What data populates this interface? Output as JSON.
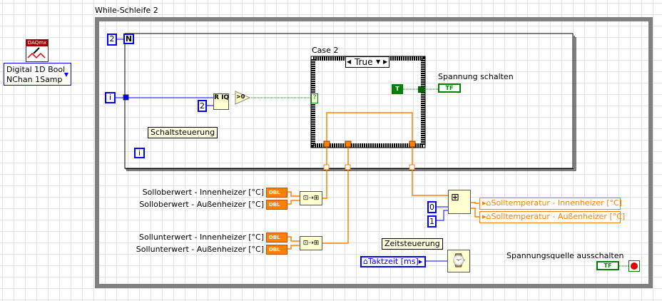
{
  "colors": {
    "numeric_wire": "#0000ff",
    "double_wire": "#ff8000",
    "boolean_wire": "#008000",
    "while_loop": "#808080"
  },
  "daqmx": {
    "icon_text": "DAQmx",
    "ring_line1": "Digital 1D Bool",
    "ring_line2": "NChan 1Samp"
  },
  "while_loop": {
    "label": "While-Schleife 2",
    "iteration": "i"
  },
  "for_loop": {
    "count_const": "2",
    "count_terminal": "N",
    "iteration": "i",
    "comment": "Schaltsteuerung",
    "divisor_const": "2",
    "quotient_icon": "R IQ",
    "compare": ">0"
  },
  "case": {
    "label": "Case 2",
    "selector_value": "True",
    "true_const": "T",
    "selector_terminal": "?"
  },
  "indicator_switch": {
    "label": "Spannung schalten",
    "type": "TF"
  },
  "controls": [
    {
      "label": "Solloberwert - Innenheizer [°C]",
      "type": "DBL"
    },
    {
      "label": "Solloberwert - Außenheizer [°C]",
      "type": "DBL"
    },
    {
      "label": "Sollunterwert - Innenheizer [°C]",
      "type": "DBL"
    },
    {
      "label": "Sollunterwert - Außenheizer [°C]",
      "type": "DBL"
    }
  ],
  "index": {
    "const0": "0",
    "const1": "1"
  },
  "indicators": [
    {
      "label": "Solltemperatur - Innenheizer [°C]"
    },
    {
      "label": "Solltemperatur - Außenheizer [°C]"
    }
  ],
  "timing": {
    "comment": "Zeitsteuerung",
    "control": "Taktzeit [ms]"
  },
  "stop": {
    "label": "Spannungsquelle ausschalten",
    "type": "TF"
  }
}
